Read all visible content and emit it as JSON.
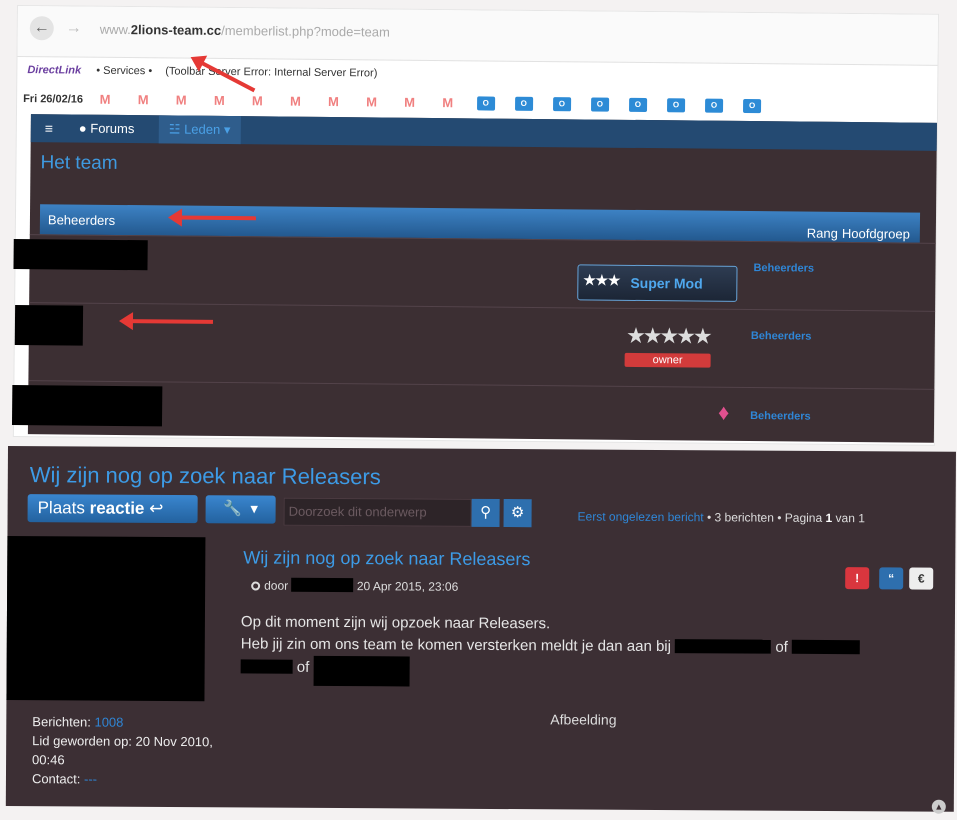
{
  "browser": {
    "url_prefix": "www.",
    "url_domain": "2lions-team.cc",
    "url_path": "/memberlist.php?mode=team",
    "toolbar_logo": "DirectLink",
    "toolbar_services": "• Services •",
    "toolbar_error": "(Toolbar Server Error: Internal Server Error)",
    "bookmarks_date": "Fri 26/02/16",
    "bookmark_gmail_icon": "M",
    "bookmark_outlook_icon": "O"
  },
  "team_page": {
    "nav": {
      "menu_icon": "≡",
      "forums": "Forums",
      "leden": "Leden"
    },
    "title": "Het team",
    "header": {
      "group": "Beheerders",
      "rank": "Rang",
      "main_group": "Hoofdgroep"
    },
    "rows": [
      {
        "rank": "Super Mod",
        "group": "Beheerders"
      },
      {
        "rank": "owner",
        "group": "Beheerders"
      },
      {
        "rank": "gem",
        "group": "Beheerders"
      }
    ]
  },
  "topic": {
    "title": "Wij zijn nog op zoek naar Releasers",
    "reply_button": {
      "prefix": "Plaats ",
      "bold": "reactie"
    },
    "search_placeholder": "Doorzoek dit onderwerp",
    "pagination": {
      "unread_link": "Eerst ongelezen bericht",
      "count": "• 3 berichten •",
      "page_prefix": "Pagina",
      "page": "1",
      "of": "van 1"
    },
    "post": {
      "title": "Wij zijn nog op zoek naar Releasers",
      "meta_by": "door",
      "date": "20 Apr 2015, 23:06",
      "line1": "Op dit moment zijn wij opzoek naar Releasers.",
      "line2_start": "Heb jij zin om ons team te komen versterken meldt je dan aan bij",
      "line2_of": "of",
      "line3_of": "of",
      "attachment": "Afbeelding"
    },
    "profile": {
      "posts_label": "Berichten:",
      "posts_value": "1008",
      "joined_label": "Lid geworden op:",
      "joined_value": "20 Nov 2010, 00:46",
      "contact_label": "Contact:",
      "contact_value": "---"
    }
  },
  "colors": {
    "accent": "#3d9be6",
    "link": "#2f86d6",
    "bg": "#3c2f34",
    "arrow": "#e53935"
  }
}
